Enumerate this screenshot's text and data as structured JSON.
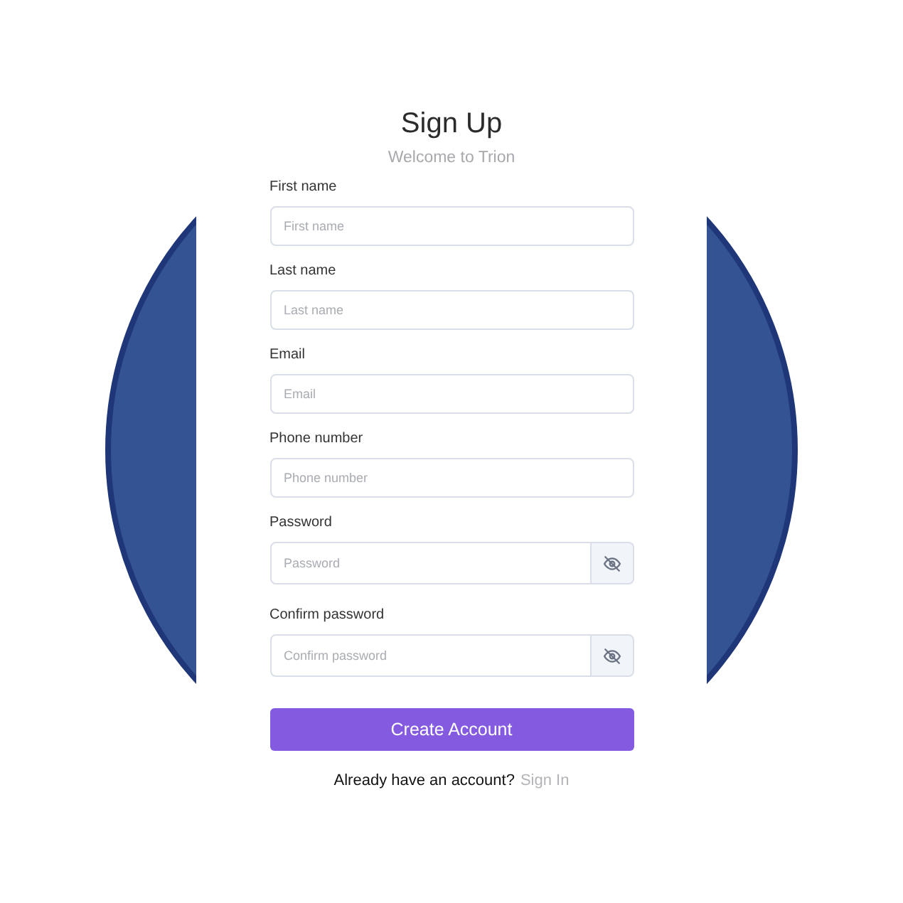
{
  "title": "Sign Up",
  "subtitle": "Welcome to Trion",
  "fields": [
    {
      "kind": "text",
      "label": "First name",
      "placeholder": "First name"
    },
    {
      "kind": "text",
      "label": "Last name",
      "placeholder": "Last name"
    },
    {
      "kind": "text",
      "label": "Email",
      "placeholder": "Email"
    },
    {
      "kind": "text",
      "label": "Phone number",
      "placeholder": "Phone number"
    },
    {
      "kind": "password",
      "label": "Password",
      "placeholder": "Password"
    },
    {
      "kind": "password",
      "label": "Confirm password",
      "placeholder": "Confirm password"
    }
  ],
  "submit": "Create Account",
  "footer": {
    "prompt": "Already have an account?",
    "link": "Sign In"
  }
}
